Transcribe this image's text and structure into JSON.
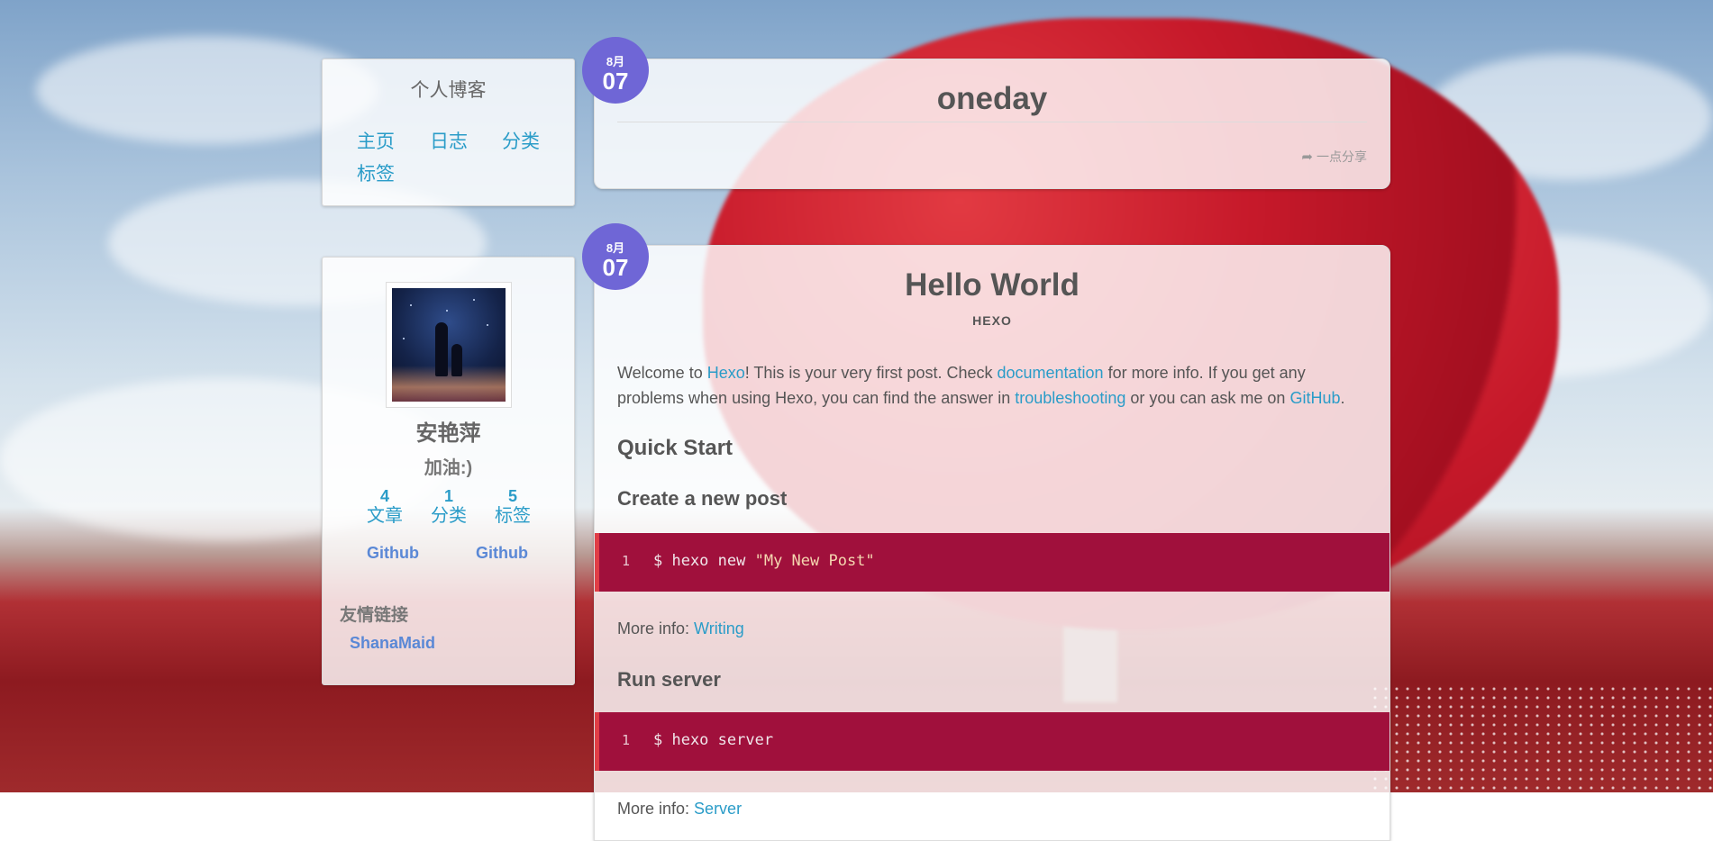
{
  "blog": {
    "title": "个人博客",
    "nav": [
      "主页",
      "日志",
      "分类",
      "标签"
    ]
  },
  "profile": {
    "name": "安艳萍",
    "motto": "加油:)",
    "stats": [
      {
        "count": "4",
        "label": "文章"
      },
      {
        "count": "1",
        "label": "分类"
      },
      {
        "count": "5",
        "label": "标签"
      }
    ],
    "social": [
      "Github",
      "Github"
    ],
    "friends_heading": "友情链接",
    "friends": [
      "ShanaMaid"
    ]
  },
  "posts": [
    {
      "month": "8月",
      "day": "07",
      "title": "oneday",
      "share_label": "一点分享"
    },
    {
      "month": "8月",
      "day": "07",
      "title": "Hello World",
      "tag": "HEXO",
      "intro": {
        "t1": "Welcome to ",
        "l1": "Hexo",
        "t2": "! This is your very first post. Check ",
        "l2": "documentation",
        "t3": " for more info. If you get any problems when using Hexo, you can find the answer in ",
        "l3": "troubleshooting",
        "t4": " or you can ask me on ",
        "l4": "GitHub",
        "t5": "."
      },
      "quick_start": "Quick Start",
      "section1": {
        "heading": "Create a new post",
        "line_no": "1",
        "cmd": "$ hexo new ",
        "arg": "\"My New Post\"",
        "more_label": "More info: ",
        "more_link": "Writing"
      },
      "section2": {
        "heading": "Run server",
        "line_no": "1",
        "cmd": "$ hexo server",
        "more_label": "More info: ",
        "more_link": "Server"
      }
    }
  ],
  "colors": {
    "link": "#2a9cc8",
    "badge": "#6f66d6",
    "code_bg": "#a0103c"
  }
}
